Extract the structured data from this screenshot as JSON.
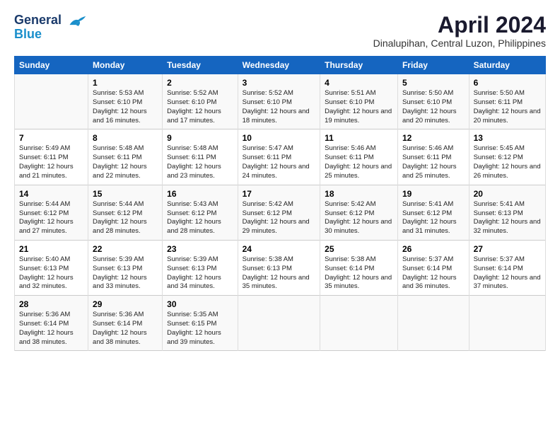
{
  "logo": {
    "line1": "General",
    "line2": "Blue"
  },
  "title": "April 2024",
  "subtitle": "Dinalupihan, Central Luzon, Philippines",
  "days_of_week": [
    "Sunday",
    "Monday",
    "Tuesday",
    "Wednesday",
    "Thursday",
    "Friday",
    "Saturday"
  ],
  "weeks": [
    [
      {
        "num": "",
        "sunrise": "",
        "sunset": "",
        "daylight": ""
      },
      {
        "num": "1",
        "sunrise": "Sunrise: 5:53 AM",
        "sunset": "Sunset: 6:10 PM",
        "daylight": "Daylight: 12 hours and 16 minutes."
      },
      {
        "num": "2",
        "sunrise": "Sunrise: 5:52 AM",
        "sunset": "Sunset: 6:10 PM",
        "daylight": "Daylight: 12 hours and 17 minutes."
      },
      {
        "num": "3",
        "sunrise": "Sunrise: 5:52 AM",
        "sunset": "Sunset: 6:10 PM",
        "daylight": "Daylight: 12 hours and 18 minutes."
      },
      {
        "num": "4",
        "sunrise": "Sunrise: 5:51 AM",
        "sunset": "Sunset: 6:10 PM",
        "daylight": "Daylight: 12 hours and 19 minutes."
      },
      {
        "num": "5",
        "sunrise": "Sunrise: 5:50 AM",
        "sunset": "Sunset: 6:10 PM",
        "daylight": "Daylight: 12 hours and 20 minutes."
      },
      {
        "num": "6",
        "sunrise": "Sunrise: 5:50 AM",
        "sunset": "Sunset: 6:11 PM",
        "daylight": "Daylight: 12 hours and 20 minutes."
      }
    ],
    [
      {
        "num": "7",
        "sunrise": "Sunrise: 5:49 AM",
        "sunset": "Sunset: 6:11 PM",
        "daylight": "Daylight: 12 hours and 21 minutes."
      },
      {
        "num": "8",
        "sunrise": "Sunrise: 5:48 AM",
        "sunset": "Sunset: 6:11 PM",
        "daylight": "Daylight: 12 hours and 22 minutes."
      },
      {
        "num": "9",
        "sunrise": "Sunrise: 5:48 AM",
        "sunset": "Sunset: 6:11 PM",
        "daylight": "Daylight: 12 hours and 23 minutes."
      },
      {
        "num": "10",
        "sunrise": "Sunrise: 5:47 AM",
        "sunset": "Sunset: 6:11 PM",
        "daylight": "Daylight: 12 hours and 24 minutes."
      },
      {
        "num": "11",
        "sunrise": "Sunrise: 5:46 AM",
        "sunset": "Sunset: 6:11 PM",
        "daylight": "Daylight: 12 hours and 25 minutes."
      },
      {
        "num": "12",
        "sunrise": "Sunrise: 5:46 AM",
        "sunset": "Sunset: 6:11 PM",
        "daylight": "Daylight: 12 hours and 25 minutes."
      },
      {
        "num": "13",
        "sunrise": "Sunrise: 5:45 AM",
        "sunset": "Sunset: 6:12 PM",
        "daylight": "Daylight: 12 hours and 26 minutes."
      }
    ],
    [
      {
        "num": "14",
        "sunrise": "Sunrise: 5:44 AM",
        "sunset": "Sunset: 6:12 PM",
        "daylight": "Daylight: 12 hours and 27 minutes."
      },
      {
        "num": "15",
        "sunrise": "Sunrise: 5:44 AM",
        "sunset": "Sunset: 6:12 PM",
        "daylight": "Daylight: 12 hours and 28 minutes."
      },
      {
        "num": "16",
        "sunrise": "Sunrise: 5:43 AM",
        "sunset": "Sunset: 6:12 PM",
        "daylight": "Daylight: 12 hours and 28 minutes."
      },
      {
        "num": "17",
        "sunrise": "Sunrise: 5:42 AM",
        "sunset": "Sunset: 6:12 PM",
        "daylight": "Daylight: 12 hours and 29 minutes."
      },
      {
        "num": "18",
        "sunrise": "Sunrise: 5:42 AM",
        "sunset": "Sunset: 6:12 PM",
        "daylight": "Daylight: 12 hours and 30 minutes."
      },
      {
        "num": "19",
        "sunrise": "Sunrise: 5:41 AM",
        "sunset": "Sunset: 6:12 PM",
        "daylight": "Daylight: 12 hours and 31 minutes."
      },
      {
        "num": "20",
        "sunrise": "Sunrise: 5:41 AM",
        "sunset": "Sunset: 6:13 PM",
        "daylight": "Daylight: 12 hours and 32 minutes."
      }
    ],
    [
      {
        "num": "21",
        "sunrise": "Sunrise: 5:40 AM",
        "sunset": "Sunset: 6:13 PM",
        "daylight": "Daylight: 12 hours and 32 minutes."
      },
      {
        "num": "22",
        "sunrise": "Sunrise: 5:39 AM",
        "sunset": "Sunset: 6:13 PM",
        "daylight": "Daylight: 12 hours and 33 minutes."
      },
      {
        "num": "23",
        "sunrise": "Sunrise: 5:39 AM",
        "sunset": "Sunset: 6:13 PM",
        "daylight": "Daylight: 12 hours and 34 minutes."
      },
      {
        "num": "24",
        "sunrise": "Sunrise: 5:38 AM",
        "sunset": "Sunset: 6:13 PM",
        "daylight": "Daylight: 12 hours and 35 minutes."
      },
      {
        "num": "25",
        "sunrise": "Sunrise: 5:38 AM",
        "sunset": "Sunset: 6:14 PM",
        "daylight": "Daylight: 12 hours and 35 minutes."
      },
      {
        "num": "26",
        "sunrise": "Sunrise: 5:37 AM",
        "sunset": "Sunset: 6:14 PM",
        "daylight": "Daylight: 12 hours and 36 minutes."
      },
      {
        "num": "27",
        "sunrise": "Sunrise: 5:37 AM",
        "sunset": "Sunset: 6:14 PM",
        "daylight": "Daylight: 12 hours and 37 minutes."
      }
    ],
    [
      {
        "num": "28",
        "sunrise": "Sunrise: 5:36 AM",
        "sunset": "Sunset: 6:14 PM",
        "daylight": "Daylight: 12 hours and 38 minutes."
      },
      {
        "num": "29",
        "sunrise": "Sunrise: 5:36 AM",
        "sunset": "Sunset: 6:14 PM",
        "daylight": "Daylight: 12 hours and 38 minutes."
      },
      {
        "num": "30",
        "sunrise": "Sunrise: 5:35 AM",
        "sunset": "Sunset: 6:15 PM",
        "daylight": "Daylight: 12 hours and 39 minutes."
      },
      {
        "num": "",
        "sunrise": "",
        "sunset": "",
        "daylight": ""
      },
      {
        "num": "",
        "sunrise": "",
        "sunset": "",
        "daylight": ""
      },
      {
        "num": "",
        "sunrise": "",
        "sunset": "",
        "daylight": ""
      },
      {
        "num": "",
        "sunrise": "",
        "sunset": "",
        "daylight": ""
      }
    ]
  ]
}
